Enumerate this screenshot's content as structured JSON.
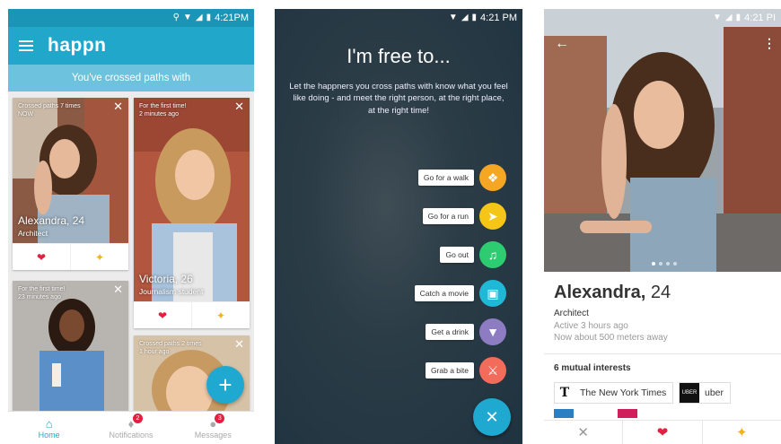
{
  "status": {
    "time": "4:21PM",
    "time_spaced": "4:21 PM",
    "time_short": "4:21 PI"
  },
  "home": {
    "app_name": "happn",
    "banner": "You've crossed paths with",
    "cards": [
      {
        "meta_line1": "Crossed paths 7 times",
        "meta_line2": "NOW",
        "name": "Alexandra, 24",
        "job": "Architect"
      },
      {
        "meta_line1": "For the first time!",
        "meta_line2": "2 minutes ago",
        "name": "Victoria, 26",
        "job": "Journalism student"
      },
      {
        "meta_line1": "For the first time!",
        "meta_line2": "23 minutes ago",
        "name": "",
        "job": ""
      },
      {
        "meta_line1": "Crossed paths 2 times",
        "meta_line2": "1 hour ago",
        "name": "",
        "job": ""
      }
    ],
    "nav": [
      {
        "label": "Home",
        "icon": "home-icon"
      },
      {
        "label": "Notifications",
        "icon": "bell-icon",
        "badge": "2"
      },
      {
        "label": "Messages",
        "icon": "chat-icon",
        "badge": "3"
      }
    ]
  },
  "free": {
    "title": "I'm free to...",
    "description": "Let the happners you cross paths with know what you feel like doing - and meet the right person, at the right place, at the right time!",
    "options": [
      {
        "label": "Go for a walk",
        "icon": "compass-icon",
        "color": "#f5a623"
      },
      {
        "label": "Go for a run",
        "icon": "runner-icon",
        "color": "#f5c518"
      },
      {
        "label": "Go out",
        "icon": "music-icon",
        "color": "#2ecc71"
      },
      {
        "label": "Catch a movie",
        "icon": "film-icon",
        "color": "#1fb8d6"
      },
      {
        "label": "Get a drink",
        "icon": "cocktail-icon",
        "color": "#8e7cc3"
      },
      {
        "label": "Grab a bite",
        "icon": "cutlery-icon",
        "color": "#f26b5b"
      }
    ]
  },
  "profile": {
    "name": "Alexandra,",
    "age": "24",
    "job": "Architect",
    "active": "Active 3 hours ago",
    "distance": "Now about 500 meters away",
    "mutual": "6 mutual interests",
    "interests": [
      {
        "label": "The New York Times",
        "icon": "nyt-logo"
      },
      {
        "label": "uber",
        "icon": "uber-logo"
      }
    ]
  },
  "colors": {
    "brand": "#21a7c9",
    "heart": "#e0213f",
    "charm": "#f2b21b"
  }
}
